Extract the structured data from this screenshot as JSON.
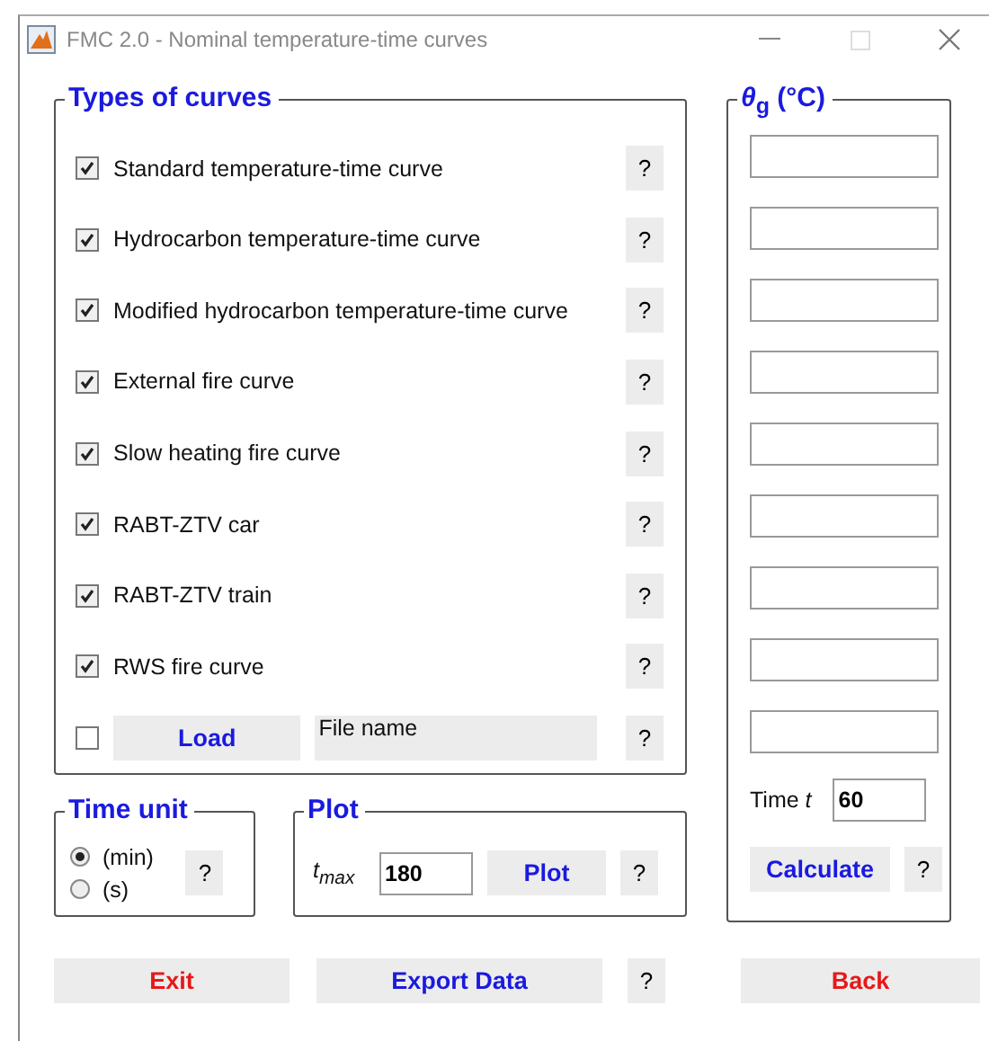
{
  "window": {
    "title": "FMC 2.0 - Nominal temperature-time curves",
    "maximize_disabled": true
  },
  "curves": {
    "title": "Types of curves",
    "items": [
      {
        "label": "Standard temperature-time curve",
        "checked": true,
        "help": "?"
      },
      {
        "label": "Hydrocarbon temperature-time curve",
        "checked": true,
        "help": "?"
      },
      {
        "label": "Modified hydrocarbon temperature-time curve",
        "checked": true,
        "help": "?"
      },
      {
        "label": "External fire curve",
        "checked": true,
        "help": "?"
      },
      {
        "label": "Slow heating fire curve",
        "checked": true,
        "help": "?"
      },
      {
        "label": "RABT-ZTV car",
        "checked": true,
        "help": "?"
      },
      {
        "label": "RABT-ZTV train",
        "checked": true,
        "help": "?"
      },
      {
        "label": "RWS fire curve",
        "checked": true,
        "help": "?"
      }
    ],
    "load": {
      "checked": false,
      "button": "Load",
      "file_name": "File name",
      "help": "?"
    }
  },
  "temperature": {
    "title": "*θ*$_{g}$ (°C)",
    "fields": [
      {
        "kind": "output"
      },
      {
        "kind": "output"
      },
      {
        "kind": "output"
      },
      {
        "kind": "output"
      },
      {
        "kind": "output"
      },
      {
        "kind": "output"
      },
      {
        "kind": "output"
      },
      {
        "kind": "output"
      },
      {
        "kind": "output"
      }
    ],
    "time_label": "Time *t*",
    "time_value": "60",
    "calculate": "Calculate",
    "help": "?"
  },
  "time_unit": {
    "title": "Time unit",
    "options": [
      {
        "label": "(min)",
        "selected": true
      },
      {
        "label": "(s)",
        "selected": false
      }
    ],
    "help": "?"
  },
  "plot": {
    "title": "Plot",
    "tmax_label": "t$_{max}$",
    "tmax_value": "180",
    "button": "Plot",
    "help": "?"
  },
  "footer": {
    "exit": "Exit",
    "export": "Export Data",
    "help": "?",
    "back": "Back"
  }
}
